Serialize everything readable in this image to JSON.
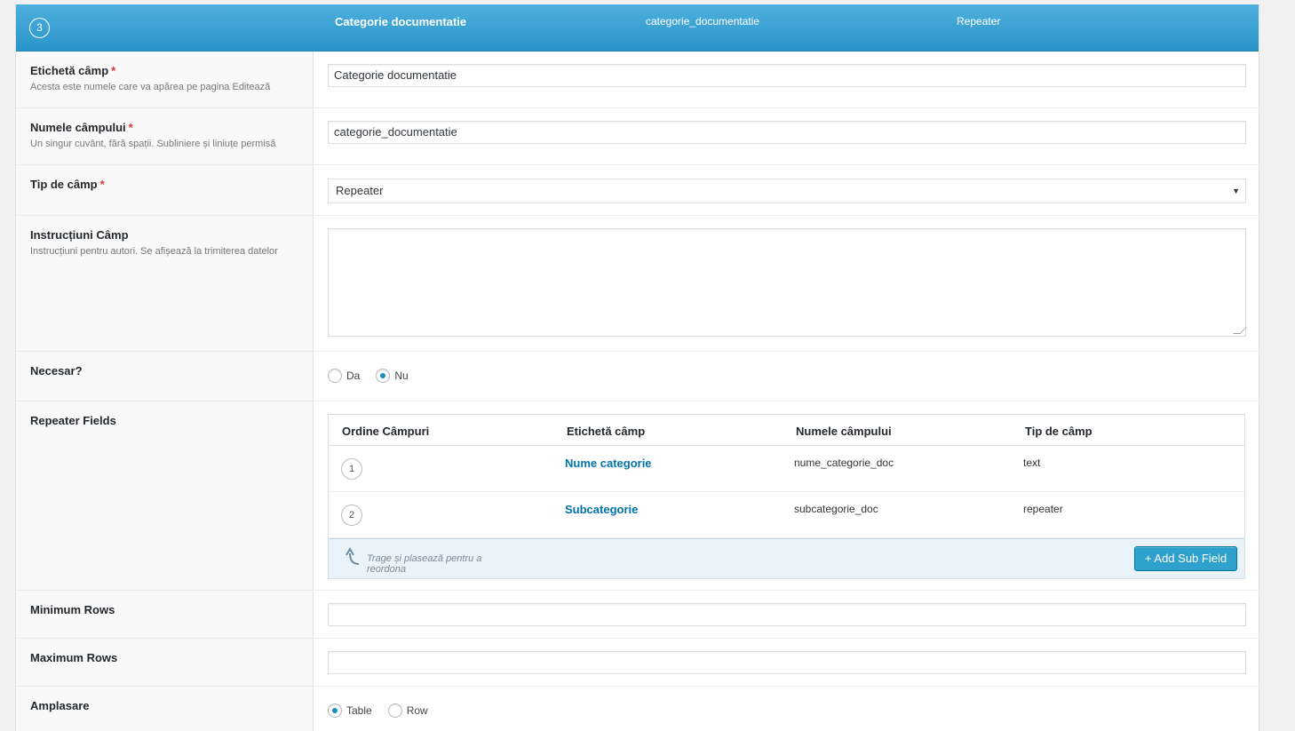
{
  "header": {
    "order": "3",
    "label": "Categorie documentatie",
    "name": "categorie_documentatie",
    "type": "Repeater"
  },
  "fields": {
    "label": {
      "title": "Etichetă câmp",
      "required_mark": "*",
      "desc": "Acesta este numele care va apărea pe pagina Editează",
      "value": "Categorie documentatie"
    },
    "name": {
      "title": "Numele câmpului",
      "required_mark": "*",
      "desc": "Un singur cuvânt, fără spații. Subliniere și liniuțe permisă",
      "value": "categorie_documentatie"
    },
    "type": {
      "title": "Tip de câmp",
      "required_mark": "*",
      "value": "Repeater"
    },
    "instructions": {
      "title": "Instrucțiuni Câmp",
      "desc": "Instrucțiuni pentru autori. Se afișează la trimiterea datelor",
      "value": ""
    },
    "required": {
      "title": "Necesar?",
      "options": [
        "Da",
        "Nu"
      ],
      "selected": "Nu"
    },
    "repeater": {
      "title": "Repeater Fields",
      "columns": [
        "Ordine Câmpuri",
        "Etichetă câmp",
        "Numele câmpului",
        "Tip de câmp"
      ],
      "rows": [
        {
          "order": "1",
          "label": "Nume categorie",
          "name": "nume_categorie_doc",
          "type": "text"
        },
        {
          "order": "2",
          "label": "Subcategorie",
          "name": "subcategorie_doc",
          "type": "repeater"
        }
      ],
      "hint": "Trage și plasează pentru a reordona",
      "add_button": "+ Add Sub Field"
    },
    "min_rows": {
      "title": "Minimum Rows",
      "value": ""
    },
    "max_rows": {
      "title": "Maximum Rows",
      "value": ""
    },
    "layout": {
      "title": "Amplasare",
      "options": [
        "Table",
        "Row"
      ],
      "selected": "Table"
    }
  },
  "colors": {
    "header_bg": "#2a95c8",
    "accent": "#0073aa",
    "button": "#2ea2cc",
    "required": "#dc3232"
  }
}
